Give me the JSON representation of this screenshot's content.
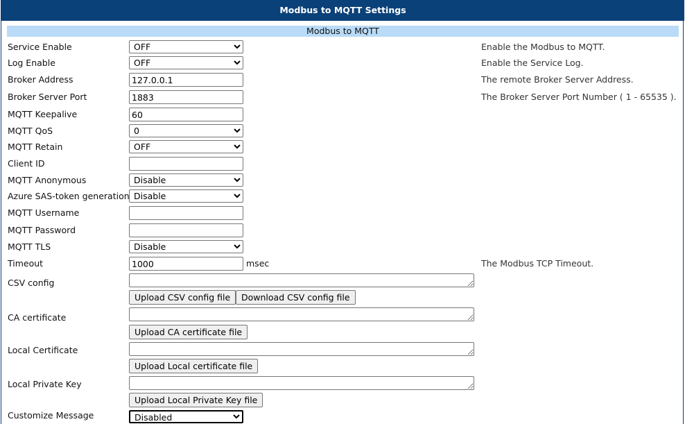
{
  "header": {
    "title": "Modbus to MQTT Settings"
  },
  "section": {
    "title": "Modbus to MQTT"
  },
  "fields": {
    "service_enable": {
      "label": "Service Enable",
      "value": "OFF",
      "hint": "Enable the Modbus to MQTT."
    },
    "log_enable": {
      "label": "Log Enable",
      "value": "OFF",
      "hint": "Enable the Service Log."
    },
    "broker_address": {
      "label": "Broker Address",
      "value": "127.0.0.1",
      "hint": "The remote Broker Server Address."
    },
    "broker_port": {
      "label": "Broker Server Port",
      "value": "1883",
      "hint": "The Broker Server Port Number ( 1 - 65535 )."
    },
    "keepalive": {
      "label": "MQTT Keepalive",
      "value": "60"
    },
    "qos": {
      "label": "MQTT QoS",
      "value": "0"
    },
    "retain": {
      "label": "MQTT Retain",
      "value": "OFF"
    },
    "client_id": {
      "label": "Client ID",
      "value": ""
    },
    "anonymous": {
      "label": "MQTT Anonymous",
      "value": "Disable"
    },
    "azure_sas": {
      "label": "Azure SAS-token generation",
      "value": "Disable"
    },
    "username": {
      "label": "MQTT Username",
      "value": ""
    },
    "password": {
      "label": "MQTT Password",
      "value": ""
    },
    "tls": {
      "label": "MQTT TLS",
      "value": "Disable"
    },
    "timeout": {
      "label": "Timeout",
      "value": "1000",
      "unit": "msec",
      "hint": "The Modbus TCP Timeout."
    },
    "csv_config": {
      "label": "CSV config",
      "value": ""
    },
    "ca_cert": {
      "label": "CA certificate",
      "value": ""
    },
    "local_cert": {
      "label": "Local Certificate",
      "value": ""
    },
    "local_key": {
      "label": "Local Private Key",
      "value": ""
    },
    "customize_message": {
      "label": "Customize Message",
      "value": "Disabled"
    }
  },
  "buttons": {
    "upload_csv": "Upload CSV config file",
    "download_csv": "Download CSV config file",
    "upload_ca": "Upload CA certificate file",
    "upload_local_cert": "Upload Local certificate file",
    "upload_local_key": "Upload Local Private Key file"
  },
  "colors": {
    "header_bg": "#0b4179",
    "section_bg": "#b9dbf7"
  }
}
